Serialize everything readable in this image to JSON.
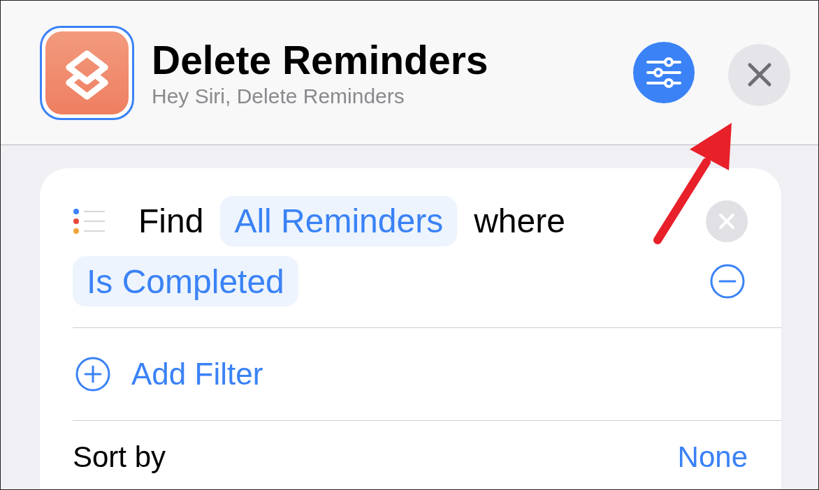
{
  "header": {
    "title": "Delete Reminders",
    "subtitle": "Hey Siri, Delete Reminders"
  },
  "action": {
    "verb": "Find",
    "source": "All Reminders",
    "connector": "where",
    "filters": [
      {
        "label": "Is Completed"
      }
    ],
    "add_filter": "Add Filter",
    "sort": {
      "label": "Sort by",
      "value": "None"
    }
  }
}
